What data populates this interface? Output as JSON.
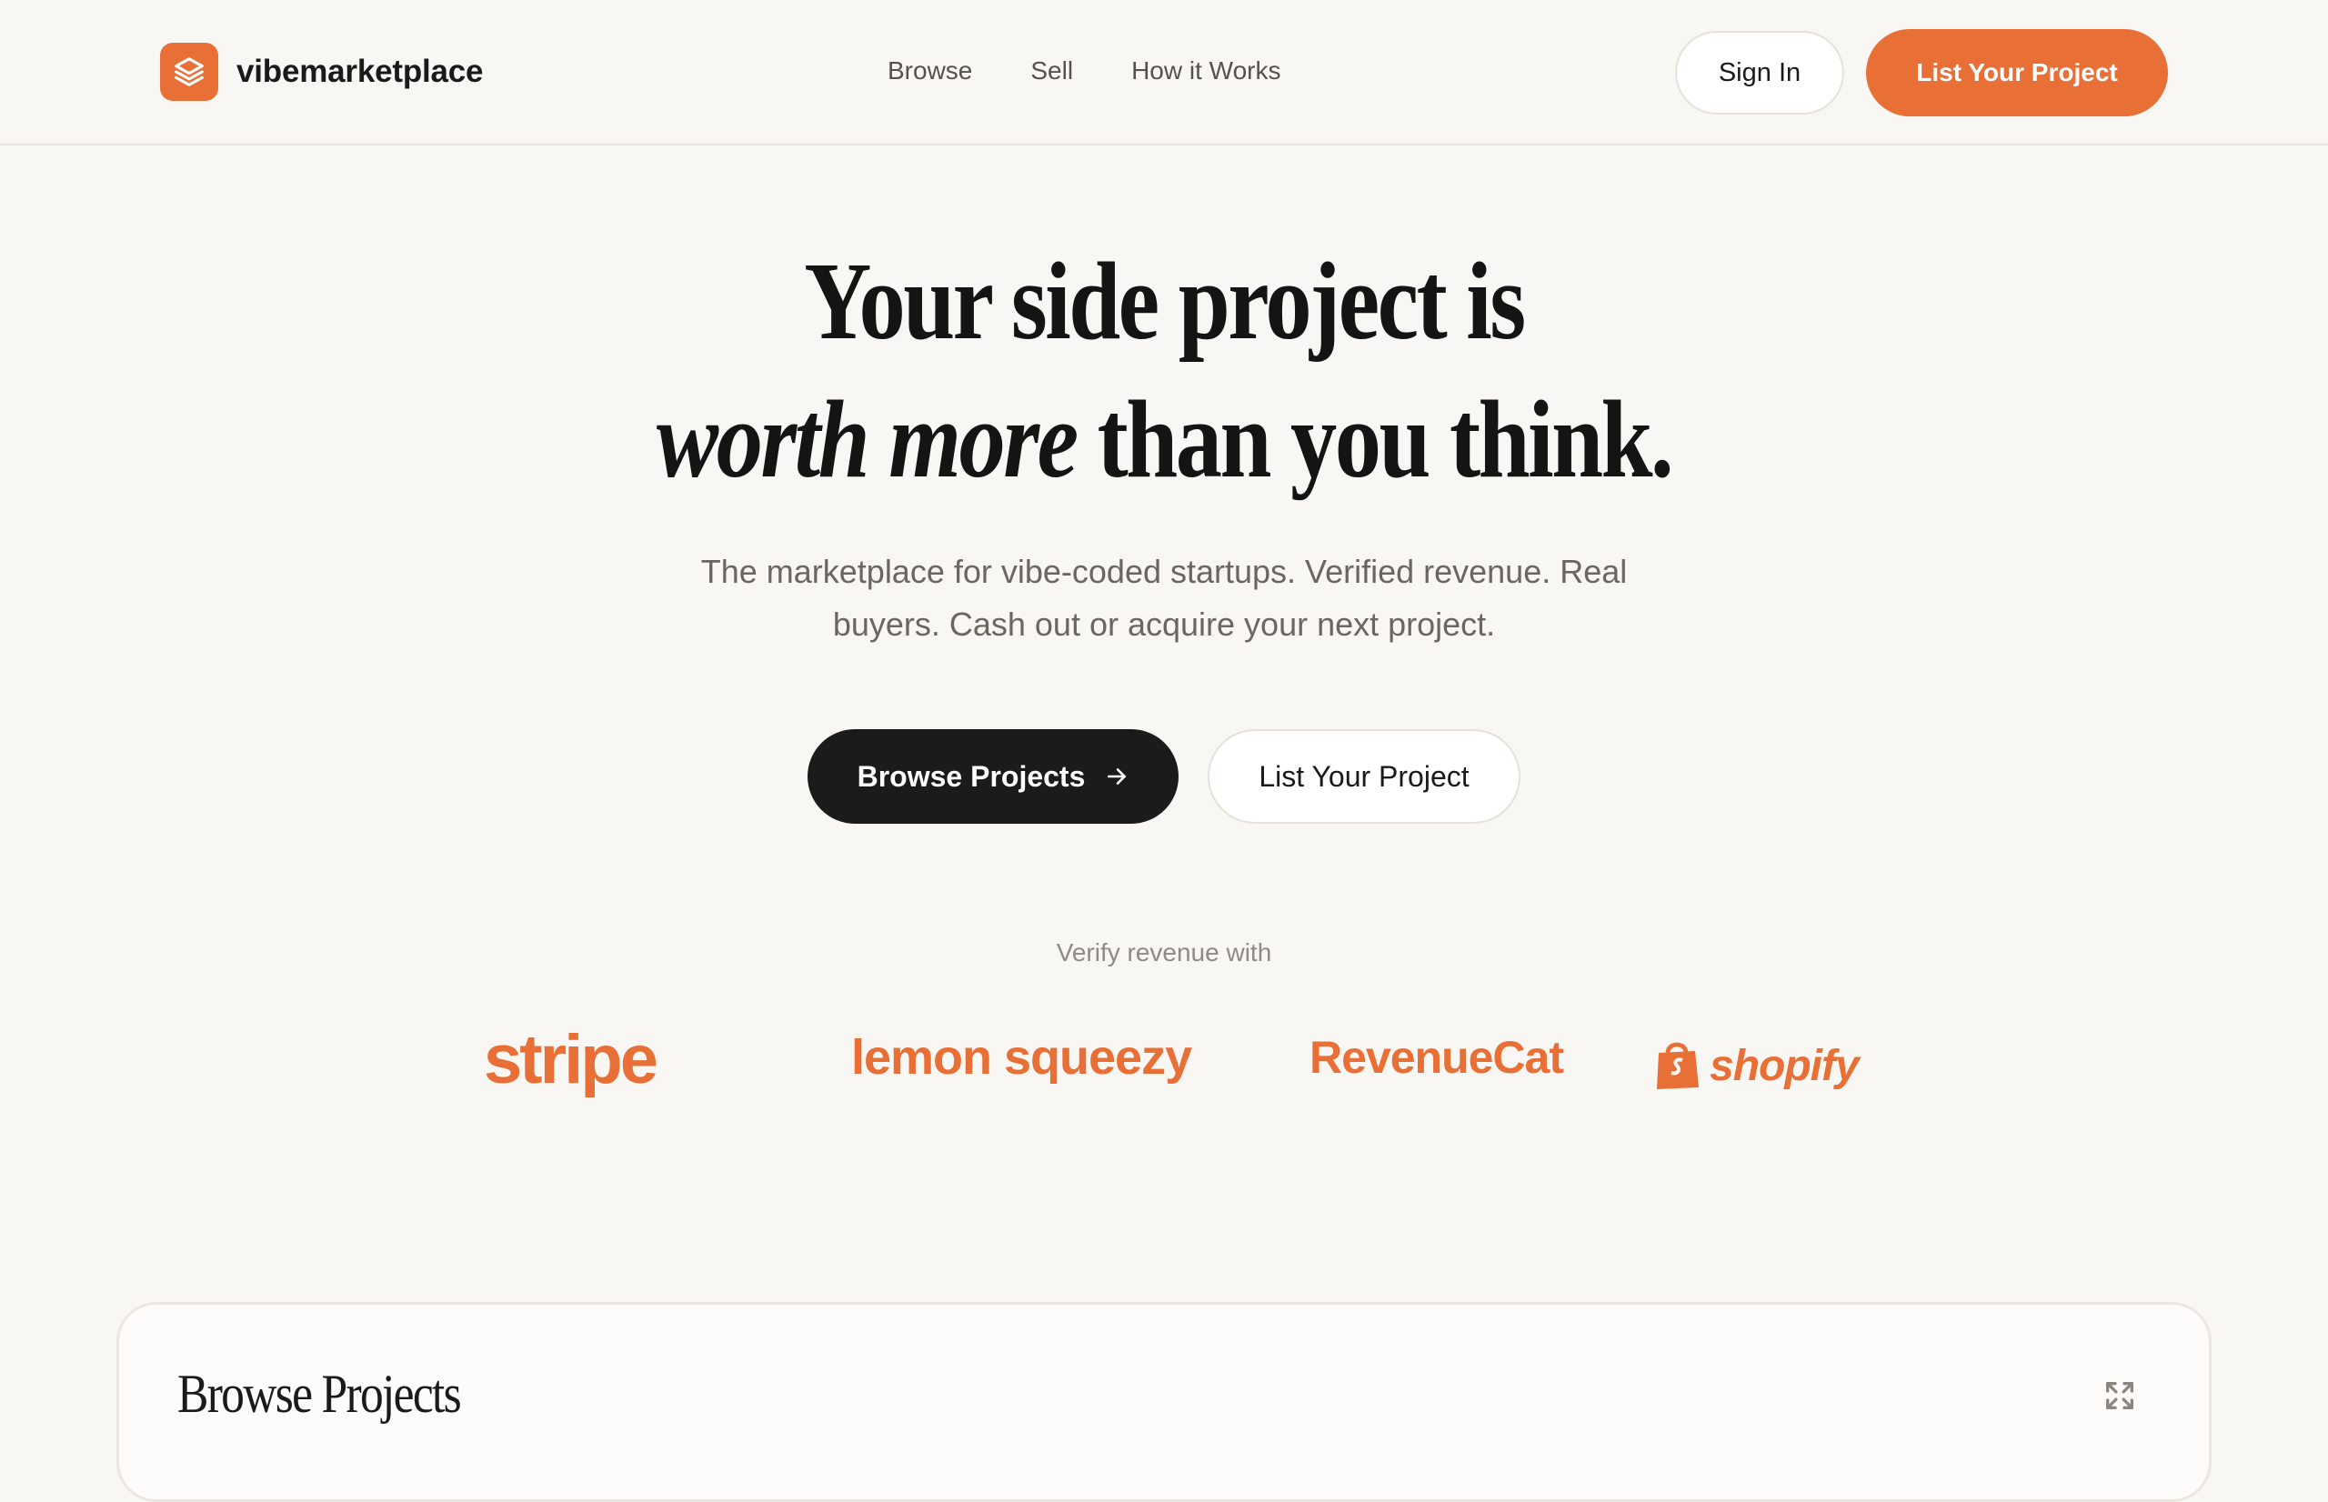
{
  "header": {
    "brand": "vibemarketplace",
    "nav": [
      "Browse",
      "Sell",
      "How it Works"
    ],
    "sign_in": "Sign In",
    "list_project": "List Your Project"
  },
  "hero": {
    "title_line1": "Your side project is",
    "title_emphasis": "worth more",
    "title_line2_rest": " than you think.",
    "subtitle": "The marketplace for vibe-coded startups. Verified revenue. Real buyers. Cash out or acquire your next project.",
    "browse_button": "Browse Projects",
    "list_button": "List Your Project"
  },
  "verify": {
    "label": "Verify revenue with",
    "partners": [
      "stripe",
      "lemon squeezy",
      "RevenueCat",
      "shopify"
    ]
  },
  "browse_panel": {
    "title": "Browse Projects"
  },
  "colors": {
    "accent": "#e86f36",
    "background": "#f9f7f3",
    "dark_button": "#1b1b1b",
    "text": "#1a1a1a",
    "muted_text": "#6b6660"
  },
  "icons": [
    "layers-icon",
    "arrow-right-icon",
    "shopping-bag-icon",
    "expand-icon"
  ]
}
